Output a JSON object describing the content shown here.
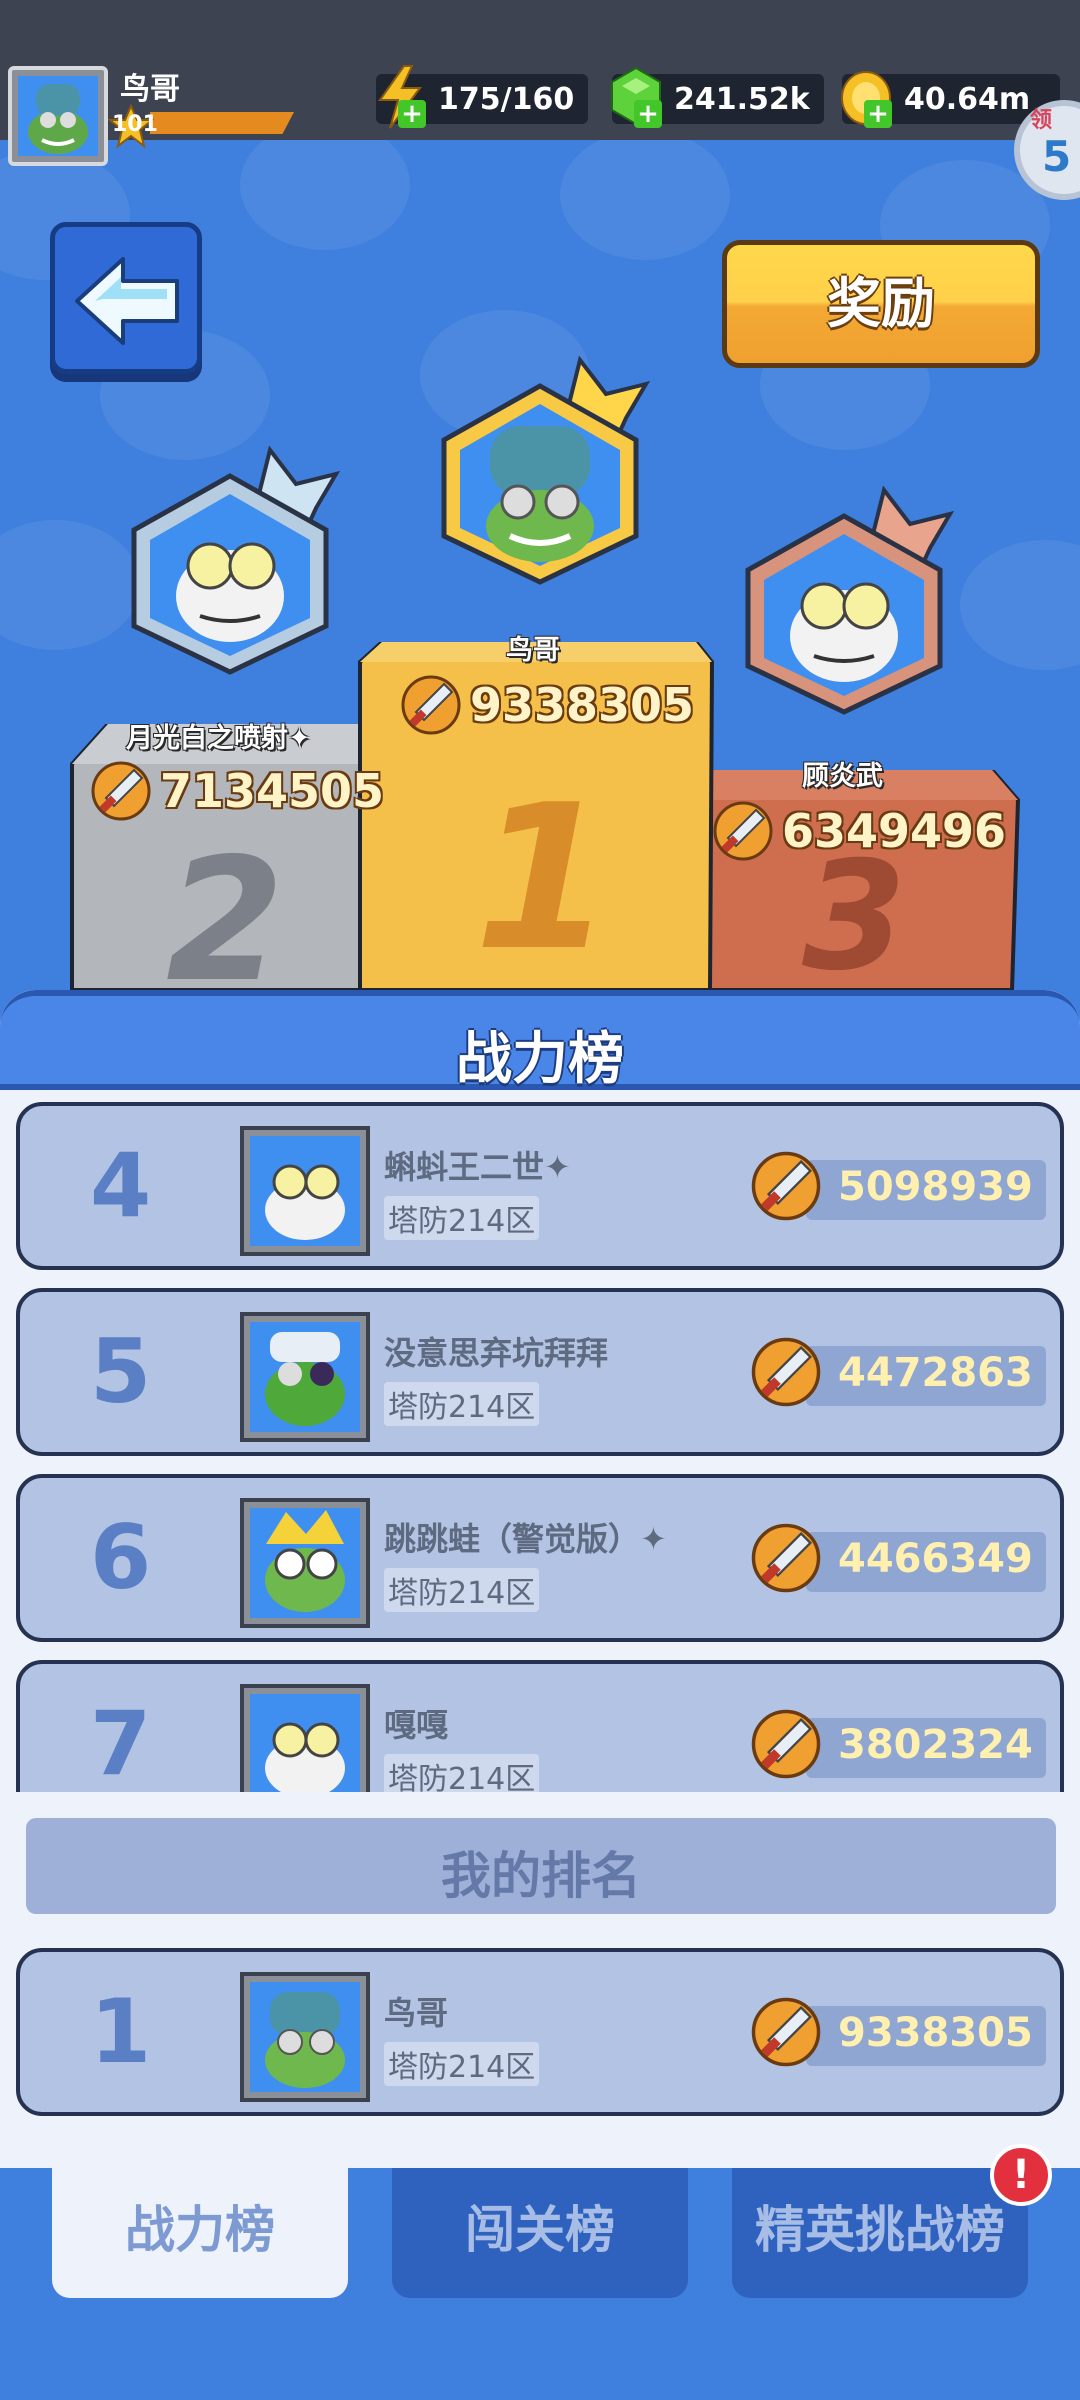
{
  "player": {
    "name": "鸟哥",
    "level": "101"
  },
  "resources": [
    {
      "icon": "energy-icon",
      "value": "175/160"
    },
    {
      "icon": "gem-icon",
      "value": "241.52k"
    },
    {
      "icon": "coin-icon",
      "value": "40.64m"
    }
  ],
  "side_badge": {
    "label": "领",
    "value": "5"
  },
  "reward_button": "奖励",
  "podium": {
    "first": {
      "name": "鸟哥",
      "score": "9338305",
      "rank": "1"
    },
    "second": {
      "name": "月光白之喷射✦",
      "score": "7134505",
      "rank": "2"
    },
    "third": {
      "name": "顾炎武",
      "score": "6349496",
      "rank": "3"
    }
  },
  "panel_title": "战力榜",
  "rankings": [
    {
      "rank": "4",
      "name": "蝌蚪王二世✦",
      "server": "塔防214区",
      "score": "5098939"
    },
    {
      "rank": "5",
      "name": "没意思弃坑拜拜",
      "server": "塔防214区",
      "score": "4472863"
    },
    {
      "rank": "6",
      "name": "跳跳蛙（警觉版）✦",
      "server": "塔防214区",
      "score": "4466349"
    },
    {
      "rank": "7",
      "name": "嘎嘎",
      "server": "塔防214区",
      "score": "3802324"
    }
  ],
  "my_rank_label": "我的排名",
  "my_rank": {
    "rank": "1",
    "name": "鸟哥",
    "server": "塔防214区",
    "score": "9338305"
  },
  "tabs": [
    {
      "label": "战力榜",
      "active": true
    },
    {
      "label": "闯关榜",
      "active": false
    },
    {
      "label": "精英挑战榜",
      "active": false
    }
  ],
  "alert_mark": "!",
  "colors": {
    "background": "#3f7fde",
    "gold": "#f4c04a",
    "silver": "#b0b3b8",
    "bronze": "#cf6e4f"
  }
}
